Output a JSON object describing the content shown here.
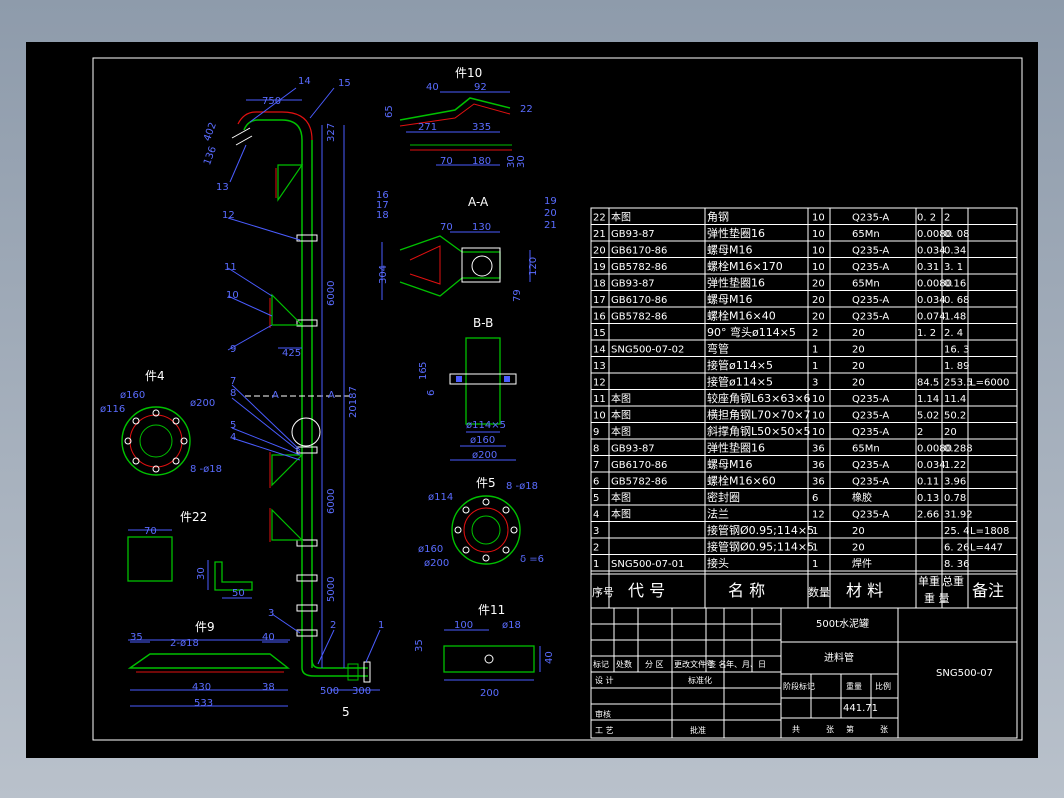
{
  "colors": {
    "background_gray": "#9aa6b4",
    "sheet": "#000000",
    "line_white": "#ffffff",
    "dim_blue": "#4a5cff",
    "part_green": "#00c000",
    "part_red": "#e01010"
  },
  "views": {
    "piece10": "件10",
    "piece4": "件4",
    "piece22": "件22",
    "piece9": "件9",
    "piece5": "件5",
    "piece11": "件11",
    "section_aa": "A-A",
    "section_bb": "B-B"
  },
  "dims": {
    "main": {
      "d750": "750",
      "d402": "402",
      "d136": "136",
      "d14": "14",
      "d15": "15",
      "d13": "13",
      "d12": "12",
      "d327": "327",
      "d11": "11",
      "d10": "10",
      "d9": "9",
      "d425": "425",
      "d6000a": "6000",
      "d20187": "20187",
      "d7": "7",
      "d8": "8",
      "d5": "5",
      "d4": "4",
      "d6000b": "6000",
      "d5000": "5000",
      "d3": "3",
      "d2": "2",
      "d1": "1",
      "d500": "500",
      "d300": "300",
      "view_mark": "5",
      "sec_a_left": "A",
      "sec_a_right": "A"
    },
    "p10": {
      "d40": "40",
      "d92": "92",
      "d22": "22",
      "d65": "65",
      "d271": "271",
      "d335": "335",
      "d70": "70",
      "d180": "180",
      "d30": "30",
      "d30b": "30"
    },
    "aa": {
      "l16": "16",
      "l17": "17",
      "l18": "18",
      "r19": "19",
      "r20": "20",
      "r21": "21",
      "d70": "70",
      "d130": "130",
      "d304": "304",
      "d120": "120",
      "d79": "79"
    },
    "bb": {
      "d5": "5",
      "d16": "16",
      "d6": "6",
      "d114": "ø114×5",
      "d160": "ø160",
      "d200": "ø200"
    },
    "p4": {
      "d160": "ø160",
      "d116": "ø116",
      "d200": "ø200",
      "holes": "8 -ø18"
    },
    "p22": {
      "d70": "70",
      "d30": "30",
      "d50": "50"
    },
    "p9": {
      "d35": "35",
      "holes": "2-ø18",
      "d40": "40",
      "d430": "430",
      "d38": "38",
      "d533": "533"
    },
    "p5": {
      "d114": "ø114",
      "holes": "8 -ø18",
      "d160": "ø160",
      "d200": "ø200",
      "thk": "δ =6"
    },
    "p11": {
      "d100": "100",
      "d18": "ø18",
      "d35": "35",
      "d40": "40",
      "d200": "200"
    }
  },
  "bom": {
    "rows": [
      [
        "22",
        "本图",
        "角钢",
        "10",
        "Q235-A",
        "0. 2",
        "2",
        ""
      ],
      [
        "21",
        "GB93-87",
        "弹性垫圈16",
        "10",
        "65Mn",
        "0.0080",
        "0. 08",
        ""
      ],
      [
        "20",
        "GB6170-86",
        "螺母M16",
        "10",
        "Q235-A",
        "0.034",
        "0.34",
        ""
      ],
      [
        "19",
        "GB5782-86",
        "螺栓M16×170",
        "10",
        "Q235-A",
        "0.31",
        "3. 1",
        ""
      ],
      [
        "18",
        "GB93-87",
        "弹性垫圈16",
        "20",
        "65Mn",
        "0.0080",
        "0.16",
        ""
      ],
      [
        "17",
        "GB6170-86",
        "螺母M16",
        "20",
        "Q235-A",
        "0.034",
        "0. 68",
        ""
      ],
      [
        "16",
        "GB5782-86",
        "螺栓M16×40",
        "20",
        "Q235-A",
        "0.074",
        "1.48",
        ""
      ],
      [
        "15",
        "",
        "90° 弯头ø114×5",
        "2",
        "20",
        "1. 2",
        "2. 4",
        ""
      ],
      [
        "14",
        "SNG500-07-02",
        "弯管",
        "1",
        "20",
        "",
        "16. 3",
        ""
      ],
      [
        "13",
        "",
        "接管ø114×5",
        "1",
        "20",
        "",
        "1. 89",
        ""
      ],
      [
        "12",
        "",
        "接管ø114×5",
        "3",
        "20",
        "84.5",
        "253.5",
        "L=6000"
      ],
      [
        "11",
        "本图",
        "较座角钢L63×63×6",
        "10",
        "Q235-A",
        "1.14",
        "11.4",
        ""
      ],
      [
        "10",
        "本图",
        "横担角钢L70×70×7",
        "10",
        "Q235-A",
        "5.02",
        "50.2",
        ""
      ],
      [
        "9",
        "本图",
        "斜撑角钢L50×50×5",
        "10",
        "Q235-A",
        "2",
        "20",
        ""
      ],
      [
        "8",
        "GB93-87",
        "弹性垫圈16",
        "36",
        "65Mn",
        "0.0080",
        "0.288",
        ""
      ],
      [
        "7",
        "GB6170-86",
        "螺母M16",
        "36",
        "Q235-A",
        "0.034",
        "1.22",
        ""
      ],
      [
        "6",
        "GB5782-86",
        "螺栓M16×60",
        "36",
        "Q235-A",
        "0.11",
        "3.96",
        ""
      ],
      [
        "5",
        "本图",
        "密封圈",
        "6",
        "橡胶",
        "0.13",
        "0.78",
        ""
      ],
      [
        "4",
        "本图",
        "法兰",
        "12",
        "Q235-A",
        "2.66",
        "31.92",
        ""
      ],
      [
        "3",
        "",
        "接管钢Ø0.95;114×5",
        "1",
        "20",
        "",
        "25. 4",
        "L=1808"
      ],
      [
        "2",
        "",
        "接管钢Ø0.95;114×5",
        "1",
        "20",
        "",
        "6. 26",
        "L=447"
      ],
      [
        "1",
        "SNG500-07-01",
        "接头",
        "1",
        "焊件",
        "",
        "8. 36",
        ""
      ]
    ],
    "header": {
      "seq": "序号",
      "code": "代 号",
      "name": "名 称",
      "qty": "数量",
      "mat": "材 料",
      "unit_w": "单重",
      "tot_w": "总重",
      "weight": "重 量",
      "note": "备注"
    }
  },
  "title_block": {
    "project": "500t水泥罐",
    "drawing_name": "进料管",
    "drawing_no": "SNG500-07",
    "weight": "441.71",
    "c_mark": "标记",
    "c_count": "处数",
    "c_zone": "分 区",
    "c_change": "更改文件号",
    "c_sign": "签 名",
    "c_date": "年、月、日",
    "c_design": "设 计",
    "c_std": "标准化",
    "c_review": "审核",
    "c_process": "工 艺",
    "c_approve": "批准",
    "c_stage": "阶段标记",
    "c_weight": "重量",
    "c_scale": "比例",
    "c_total": "共",
    "c_sheet": "第",
    "c_zhang1": "张",
    "c_zhang2": "张"
  }
}
